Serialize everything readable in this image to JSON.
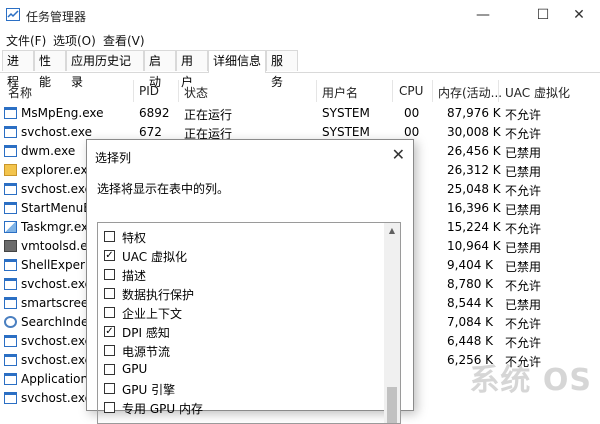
{
  "window": {
    "title": "任务管理器",
    "minimize_glyph": "—",
    "maximize_glyph": "☐",
    "close_glyph": "✕"
  },
  "menu": [
    "文件(F)",
    "选项(O)",
    "查看(V)"
  ],
  "tabs": [
    {
      "label": "进程",
      "active": false
    },
    {
      "label": "性能",
      "active": false
    },
    {
      "label": "应用历史记录",
      "active": false
    },
    {
      "label": "启动",
      "active": false
    },
    {
      "label": "用户",
      "active": false
    },
    {
      "label": "详细信息",
      "active": true
    },
    {
      "label": "服务",
      "active": false
    }
  ],
  "columns": {
    "name": "名称",
    "pid": "PID",
    "status": "状态",
    "user": "用户名",
    "cpu": "CPU",
    "memory": "内存(活动...",
    "uac": "UAC 虚拟化"
  },
  "processes": [
    {
      "name": "MsMpEng.exe",
      "pid": "6892",
      "status": "正在运行",
      "user": "SYSTEM",
      "cpu": "00",
      "memory": "87,976 K",
      "uac": "不允许",
      "icon": "exe-window-icon"
    },
    {
      "name": "svchost.exe",
      "pid": "672",
      "status": "正在运行",
      "user": "SYSTEM",
      "cpu": "00",
      "memory": "30,008 K",
      "uac": "不允许",
      "icon": "exe-window-icon"
    },
    {
      "name": "dwm.exe",
      "pid": "",
      "status": "",
      "user": "",
      "cpu": "",
      "memory": "26,456 K",
      "uac": "已禁用",
      "icon": "exe-window-icon"
    },
    {
      "name": "explorer.exe",
      "pid": "",
      "status": "",
      "user": "",
      "cpu": "",
      "memory": "26,312 K",
      "uac": "已禁用",
      "icon": "folder-icon"
    },
    {
      "name": "svchost.exe",
      "pid": "",
      "status": "",
      "user": "",
      "cpu": "",
      "memory": "25,048 K",
      "uac": "不允许",
      "icon": "exe-window-icon"
    },
    {
      "name": "StartMenuEx",
      "pid": "",
      "status": "",
      "user": "",
      "cpu": "",
      "memory": "16,396 K",
      "uac": "已禁用",
      "icon": "exe-window-icon"
    },
    {
      "name": "Taskmgr.exe",
      "pid": "",
      "status": "",
      "user": "",
      "cpu": "",
      "memory": "15,224 K",
      "uac": "不允许",
      "icon": "taskmgr-icon"
    },
    {
      "name": "vmtoolsd.exe",
      "pid": "",
      "status": "",
      "user": "",
      "cpu": "",
      "memory": "10,964 K",
      "uac": "已禁用",
      "icon": "vm-icon"
    },
    {
      "name": "ShellExperien",
      "pid": "",
      "status": "",
      "user": "",
      "cpu": "",
      "memory": "9,404 K",
      "uac": "已禁用",
      "icon": "exe-window-icon"
    },
    {
      "name": "svchost.exe",
      "pid": "",
      "status": "",
      "user": "",
      "cpu": "",
      "memory": "8,780 K",
      "uac": "不允许",
      "icon": "exe-window-icon"
    },
    {
      "name": "smartscreen.",
      "pid": "",
      "status": "",
      "user": "",
      "cpu": "",
      "memory": "8,544 K",
      "uac": "已禁用",
      "icon": "exe-window-icon"
    },
    {
      "name": "SearchIndex",
      "pid": "",
      "status": "",
      "user": "",
      "cpu": "",
      "memory": "7,084 K",
      "uac": "不允许",
      "icon": "search-index-icon"
    },
    {
      "name": "svchost.exe",
      "pid": "",
      "status": "",
      "user": "",
      "cpu": "",
      "memory": "6,448 K",
      "uac": "不允许",
      "icon": "exe-window-icon"
    },
    {
      "name": "svchost.exe",
      "pid": "",
      "status": "",
      "user": "",
      "cpu": "",
      "memory": "6,256 K",
      "uac": "不允许",
      "icon": "exe-window-icon"
    },
    {
      "name": "ApplicationF",
      "pid": "",
      "status": "",
      "user": "",
      "cpu": "",
      "memory": "",
      "uac": "",
      "icon": "exe-window-icon"
    },
    {
      "name": "svchost.exe",
      "pid": "",
      "status": "",
      "user": "",
      "cpu": "",
      "memory": "",
      "uac": "",
      "icon": "exe-window-icon"
    }
  ],
  "dialog": {
    "title": "选择列",
    "close_glyph": "✕",
    "description": "选择将显示在表中的列。",
    "options": [
      {
        "label": "特权",
        "checked": false
      },
      {
        "label": "UAC 虚拟化",
        "checked": true
      },
      {
        "label": "描述",
        "checked": false
      },
      {
        "label": "数据执行保护",
        "checked": false
      },
      {
        "label": "企业上下文",
        "checked": false
      },
      {
        "label": "DPI 感知",
        "checked": true
      },
      {
        "label": "电源节流",
        "checked": false
      },
      {
        "label": "GPU",
        "checked": false
      },
      {
        "label": "GPU 引擎",
        "checked": false
      },
      {
        "label": "专用 GPU 内存",
        "checked": false
      }
    ],
    "scroll_up_glyph": "▲"
  },
  "watermark": "系统 OS",
  "colors": {
    "accent_blue": "#1a73c9",
    "border_gray": "#d9d9d9"
  }
}
